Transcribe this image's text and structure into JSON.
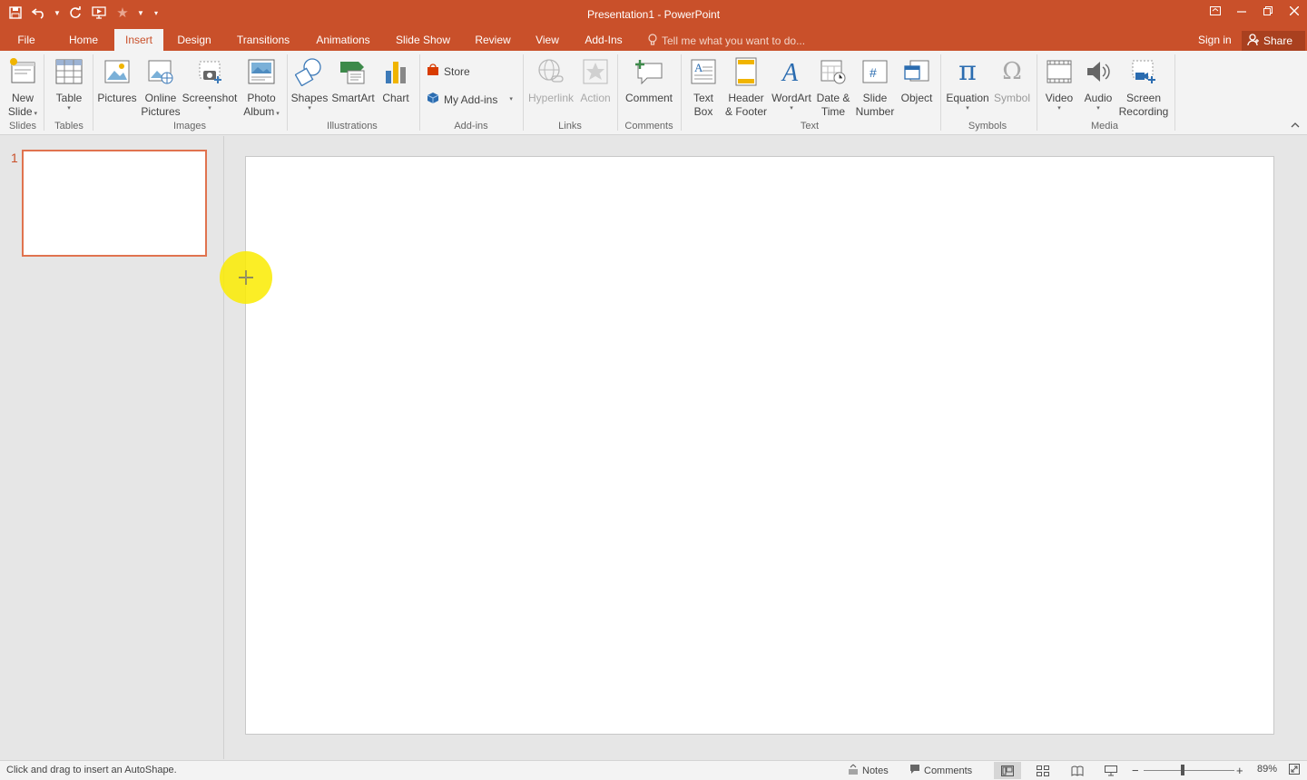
{
  "window": {
    "title": "Presentation1 - PowerPoint"
  },
  "tabs": [
    {
      "label": "File"
    },
    {
      "label": "Home"
    },
    {
      "label": "Insert"
    },
    {
      "label": "Design"
    },
    {
      "label": "Transitions"
    },
    {
      "label": "Animations"
    },
    {
      "label": "Slide Show"
    },
    {
      "label": "Review"
    },
    {
      "label": "View"
    },
    {
      "label": "Add-Ins"
    }
  ],
  "tell_me": "Tell me what you want to do...",
  "sign_in": "Sign in",
  "share": "Share",
  "ribbon": {
    "new_slide": {
      "line1": "New",
      "line2": "Slide"
    },
    "table": "Table",
    "pictures": "Pictures",
    "online_pictures": {
      "line1": "Online",
      "line2": "Pictures"
    },
    "screenshot": "Screenshot",
    "photo_album": {
      "line1": "Photo",
      "line2": "Album"
    },
    "shapes": "Shapes",
    "smartart": "SmartArt",
    "chart": "Chart",
    "store": "Store",
    "my_addins": "My Add-ins",
    "hyperlink": "Hyperlink",
    "action": "Action",
    "comment": "Comment",
    "text_box": {
      "line1": "Text",
      "line2": "Box"
    },
    "header_footer": {
      "line1": "Header",
      "line2": "& Footer"
    },
    "wordart": "WordArt",
    "date_time": {
      "line1": "Date &",
      "line2": "Time"
    },
    "slide_number": {
      "line1": "Slide",
      "line2": "Number"
    },
    "object": "Object",
    "equation": "Equation",
    "symbol": "Symbol",
    "video": "Video",
    "audio": "Audio",
    "screen_recording": {
      "line1": "Screen",
      "line2": "Recording"
    },
    "groups": {
      "slides": "Slides",
      "tables": "Tables",
      "images": "Images",
      "illustrations": "Illustrations",
      "addins": "Add-ins",
      "links": "Links",
      "comments": "Comments",
      "text": "Text",
      "symbols": "Symbols",
      "media": "Media"
    }
  },
  "thumbnails": [
    {
      "number": "1"
    }
  ],
  "status": {
    "message": "Click and drag to insert an AutoShape.",
    "notes": "Notes",
    "comments": "Comments",
    "zoom": "89%"
  },
  "colors": {
    "accent": "#c9502a",
    "highlight": "#faeb00"
  }
}
